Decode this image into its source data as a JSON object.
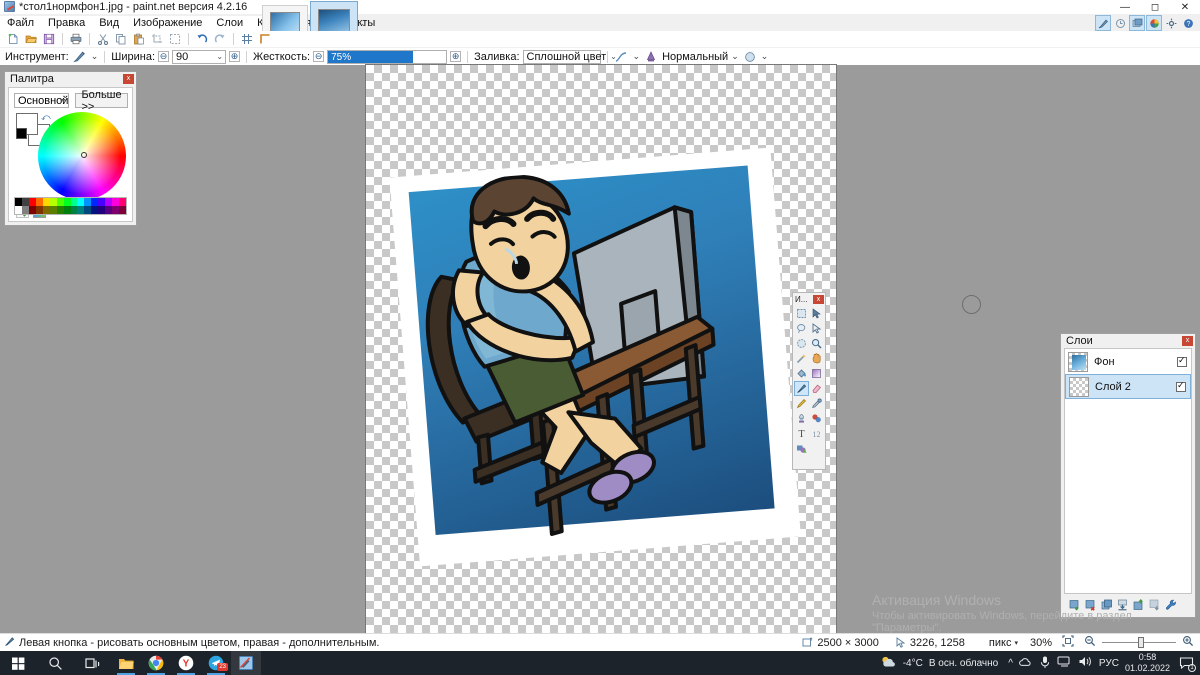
{
  "window": {
    "title": "*стол1нормфон1.jpg - paint.net версия 4.2.16",
    "app_icon": "paintnet-icon",
    "minimize": "—",
    "maximize": "◻",
    "close": "✕"
  },
  "panel_toggles": [
    {
      "name": "tools-panel-toggle",
      "glyph": "✎",
      "active": true
    },
    {
      "name": "history-panel-toggle",
      "glyph": "◷",
      "active": false
    },
    {
      "name": "layers-panel-toggle",
      "glyph": "▣",
      "active": true
    },
    {
      "name": "colors-panel-toggle",
      "glyph": "◉",
      "active": true
    },
    {
      "name": "settings-button",
      "glyph": "⚙",
      "active": false
    },
    {
      "name": "help-button",
      "glyph": "?",
      "active": false
    }
  ],
  "menubar": [
    {
      "label": "Файл",
      "name": "menu-file"
    },
    {
      "label": "Правка",
      "name": "menu-edit"
    },
    {
      "label": "Вид",
      "name": "menu-view"
    },
    {
      "label": "Изображение",
      "name": "menu-image"
    },
    {
      "label": "Слои",
      "name": "menu-layers"
    },
    {
      "label": "Коррекция",
      "name": "menu-adjustments"
    },
    {
      "label": "Эффекты",
      "name": "menu-effects"
    }
  ],
  "doc_tabs": [
    {
      "name": "document-thumbnail-1",
      "selected": false
    },
    {
      "name": "document-thumbnail-2",
      "selected": true
    }
  ],
  "toolbar_icons": [
    {
      "name": "new-icon",
      "glyph": "🗋"
    },
    {
      "name": "open-icon",
      "glyph": "📂"
    },
    {
      "name": "save-icon",
      "glyph": "💾"
    },
    {
      "name": "print-icon",
      "glyph": "🖨"
    },
    {
      "name": "cut-icon",
      "glyph": "✂"
    },
    {
      "name": "copy-icon",
      "glyph": "⧉"
    },
    {
      "name": "paste-icon",
      "glyph": "📋"
    },
    {
      "name": "crop-icon",
      "glyph": "⛶"
    },
    {
      "name": "deselect-icon",
      "glyph": "⬚"
    },
    {
      "name": "undo-icon",
      "glyph": "↶"
    },
    {
      "name": "redo-icon",
      "glyph": "↷"
    },
    {
      "name": "grid-icon",
      "glyph": "▦"
    },
    {
      "name": "rulers-icon",
      "glyph": "⌐"
    }
  ],
  "options_bar": {
    "tool_label": "Инструмент:",
    "tool_icon": "paintbrush-icon",
    "width_label": "Ширина:",
    "width_value": "90",
    "hardness_label": "Жесткость:",
    "hardness_value": "75%",
    "hardness_percent": 72,
    "fill_label": "Заливка:",
    "fill_value": "Сплошной цвет",
    "antialias_icon": "antialiasing-icon",
    "blend_icon": "blend-mode-icon",
    "blend_value": "Нормальный",
    "alpha_icon": "alpha-blending-icon",
    "caret": "⌄",
    "minus": "⊖",
    "plus": "⊕"
  },
  "palette_window": {
    "title": "Палитра",
    "close": "x",
    "mode": "Основной",
    "more_button": "Больше >>",
    "primary_color": "#ffffff",
    "secondary_color": "#ffffff",
    "swatch_strip_row1": [
      "#000000",
      "#404040",
      "#ff0000",
      "#ff6a00",
      "#ffd800",
      "#b6ff00",
      "#4cff00",
      "#00ff21",
      "#00ff90",
      "#00ffff",
      "#0094ff",
      "#0026ff",
      "#4800ff",
      "#b200ff",
      "#ff00dc",
      "#ff006e"
    ],
    "swatch_strip_row2": [
      "#ffffff",
      "#808080",
      "#7f0000",
      "#7f3300",
      "#7f6a00",
      "#5b7f00",
      "#267f00",
      "#007f0e",
      "#007f46",
      "#007f7f",
      "#004a7f",
      "#00137f",
      "#21007f",
      "#57007f",
      "#7f006e",
      "#7f0037"
    ],
    "add-color": "+",
    "color-picker-button": "palette-icon",
    "dropdown": "▾"
  },
  "tools_palette": {
    "title": "И...",
    "close": "x",
    "tools": [
      {
        "name": "rectangle-select-tool",
        "glyph": "▢",
        "selected": false
      },
      {
        "name": "move-selected-tool",
        "glyph": "✥",
        "selected": false
      },
      {
        "name": "lasso-select-tool",
        "glyph": "◠",
        "selected": false
      },
      {
        "name": "move-selection-tool",
        "glyph": "⇱",
        "selected": false
      },
      {
        "name": "ellipse-select-tool",
        "glyph": "◯",
        "selected": false
      },
      {
        "name": "zoom-tool",
        "glyph": "🔍",
        "selected": false
      },
      {
        "name": "magic-wand-tool",
        "glyph": "✦",
        "selected": false
      },
      {
        "name": "pan-tool",
        "glyph": "✋",
        "selected": false
      },
      {
        "name": "paint-bucket-tool",
        "glyph": "🪣",
        "selected": false
      },
      {
        "name": "gradient-tool",
        "glyph": "▤",
        "selected": false
      },
      {
        "name": "paintbrush-tool",
        "glyph": "🖌",
        "selected": true
      },
      {
        "name": "eraser-tool",
        "glyph": "◇",
        "selected": false
      },
      {
        "name": "pencil-tool",
        "glyph": "✐",
        "selected": false
      },
      {
        "name": "color-picker-tool",
        "glyph": "⚲",
        "selected": false
      },
      {
        "name": "clone-stamp-tool",
        "glyph": "⚱",
        "selected": false
      },
      {
        "name": "recolor-tool",
        "glyph": "❀",
        "selected": false
      },
      {
        "name": "text-tool",
        "glyph": "T",
        "selected": false
      },
      {
        "name": "line-curve-tool",
        "glyph": "⌇",
        "selected": false
      },
      {
        "name": "shapes-tool",
        "glyph": "⬟",
        "selected": false
      }
    ]
  },
  "layers_window": {
    "title": "Слои",
    "close": "x",
    "layers": [
      {
        "name": "Фон",
        "visible": true,
        "selected": false,
        "thumb": "image"
      },
      {
        "name": "Слой 2",
        "visible": true,
        "selected": true,
        "thumb": "transparent"
      }
    ],
    "toolbar": [
      {
        "name": "add-layer-button",
        "glyph": "▣"
      },
      {
        "name": "delete-layer-button",
        "glyph": "▣"
      },
      {
        "name": "duplicate-layer-button",
        "glyph": "▣"
      },
      {
        "name": "merge-layer-down-button",
        "glyph": "▣"
      },
      {
        "name": "import-layer-button",
        "glyph": "▣"
      },
      {
        "name": "move-layer-down-button",
        "glyph": "▣"
      },
      {
        "name": "layer-properties-button",
        "glyph": "🔧"
      }
    ]
  },
  "watermark": {
    "line1": "Активация Windows",
    "line2": "Чтобы активировать Windows, перейдите в раздел \"Параметры\"."
  },
  "statusbar": {
    "hint_icon": "paintbrush-icon",
    "hint": "Левая кнопка - рисовать основным цветом, правая - дополнительным.",
    "image_size_icon": "image-size-icon",
    "image_size": "2500 × 3000",
    "cursor_icon": "cursor-position-icon",
    "cursor_position": "3226, 1258",
    "units": "пикс",
    "units_caret": "▾",
    "zoom_level": "30%",
    "fit_icon": "fit-to-window-icon",
    "zoom_out_icon": "zoom-out-icon",
    "zoom_in_icon": "zoom-in-icon"
  },
  "taskbar": {
    "start": "⊞",
    "search_icon": "search-icon",
    "taskview_icon": "task-view-icon",
    "apps": [
      {
        "name": "explorer-taskbar-icon",
        "glyph": "📁",
        "active": false
      },
      {
        "name": "chrome-taskbar-icon",
        "glyph": "◉",
        "active": false
      },
      {
        "name": "yandex-taskbar-icon",
        "glyph": "Y",
        "active": false
      },
      {
        "name": "telegram-taskbar-icon",
        "glyph": "✈",
        "active": false,
        "badge": "23"
      },
      {
        "name": "paintnet-taskbar-icon",
        "glyph": "🖌",
        "active": true
      }
    ],
    "tray": {
      "weather_icon": "partly-cloudy-icon",
      "temperature": "-4°C",
      "weather_text": "В осн. облачно",
      "chevron": "^",
      "icons": [
        {
          "name": "onedrive-tray-icon",
          "glyph": "☁"
        },
        {
          "name": "microphone-tray-icon",
          "glyph": "🎤"
        },
        {
          "name": "network-tray-icon",
          "glyph": "🖵"
        },
        {
          "name": "volume-tray-icon",
          "glyph": "🔊"
        }
      ],
      "language": "РУС",
      "time": "0:58",
      "date": "01.02.2022",
      "notification_icon": "notification-icon",
      "notification_count": "1"
    }
  }
}
